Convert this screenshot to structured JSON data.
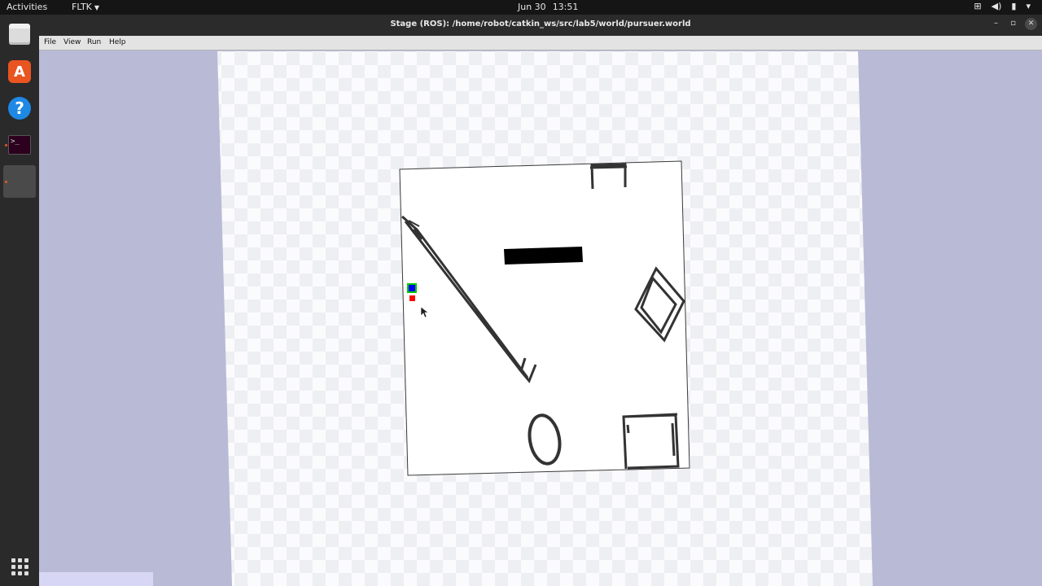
{
  "topbar": {
    "activities": "Activities",
    "app_menu": "FLTK",
    "date": "Jun 30",
    "time": "13:51"
  },
  "dock": {
    "items": [
      {
        "name": "files",
        "icon": "files-icon"
      },
      {
        "name": "ubuntu-software",
        "icon": "software-icon"
      },
      {
        "name": "help",
        "icon": "help-icon"
      },
      {
        "name": "terminal",
        "icon": "terminal-icon"
      },
      {
        "name": "stage",
        "icon": "blank-app-icon"
      }
    ],
    "show_apps_icon": "grid-icon"
  },
  "window": {
    "title": "Stage (ROS): /home/robot/catkin_ws/src/lab5/world/pursuer.world",
    "menu": [
      "File",
      "View",
      "Run",
      "Help"
    ]
  },
  "colors": {
    "background": "#b9bad6",
    "robot_pursuer": "#0000ff",
    "robot_outline": "#00cc00",
    "robot_evader": "#ff0000",
    "obstacle": "#000000"
  }
}
